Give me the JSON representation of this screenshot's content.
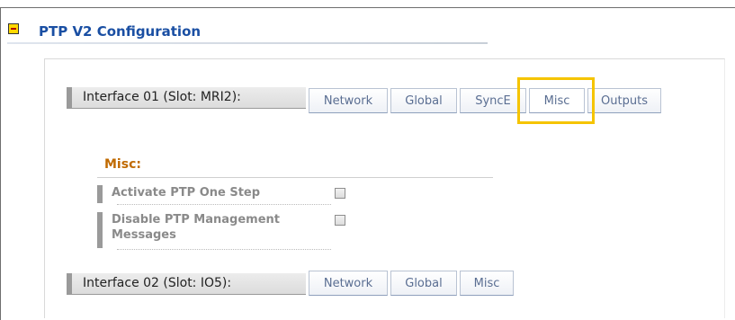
{
  "section": {
    "title": "PTP V2 Configuration",
    "collapse_icon": "collapse-minus-icon"
  },
  "interfaces": [
    {
      "label": "Interface 01 (Slot: MRI2):",
      "tabs": [
        "Network",
        "Global",
        "SyncE",
        "Misc",
        "Outputs"
      ],
      "active_tab": "Misc"
    },
    {
      "label": "Interface 02 (Slot: IO5):",
      "tabs": [
        "Network",
        "Global",
        "Misc"
      ]
    }
  ],
  "misc": {
    "title": "Misc:",
    "options": [
      {
        "label": "Activate PTP One Step",
        "checked": false
      },
      {
        "label_line1": "Disable PTP Management",
        "label_line2": "Messages",
        "checked": false
      }
    ]
  },
  "colors": {
    "title": "#1a4fa3",
    "misc_heading": "#c06a00",
    "highlight": "#f5c400"
  }
}
